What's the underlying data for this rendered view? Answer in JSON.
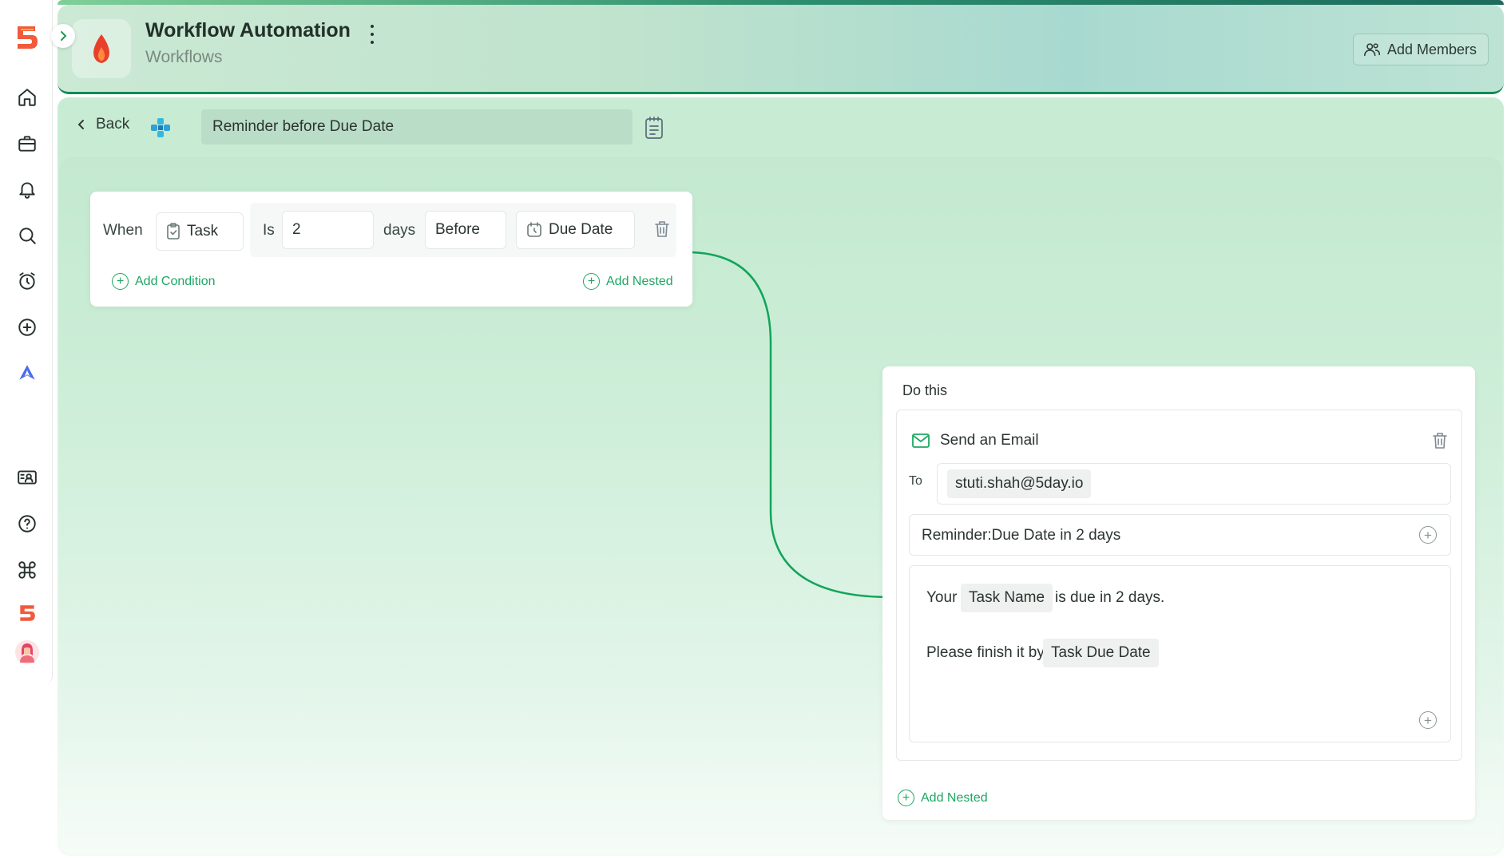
{
  "header": {
    "title": "Workflow Automation",
    "subtitle": "Workflows",
    "add_members_label": "Add Members"
  },
  "sidebar": {
    "items": [
      {
        "icon": "home-icon"
      },
      {
        "icon": "briefcase-icon"
      },
      {
        "icon": "bell-icon"
      },
      {
        "icon": "search-icon"
      },
      {
        "icon": "alarm-clock-icon"
      },
      {
        "icon": "plus-circle-icon"
      },
      {
        "icon": "rocket-a-icon"
      },
      {
        "icon": "support-card-icon"
      },
      {
        "icon": "help-icon"
      },
      {
        "icon": "command-icon"
      },
      {
        "icon": "brand-logo-icon"
      },
      {
        "icon": "user-avatar"
      }
    ]
  },
  "toolbar": {
    "back_label": "Back",
    "workflow_name": "Reminder before Due Date"
  },
  "trigger": {
    "when_label": "When",
    "entity": "Task",
    "is_label": "Is",
    "value": "2",
    "unit": "days",
    "relation": "Before",
    "field": "Due Date",
    "add_condition_label": "Add Condition",
    "add_nested_label": "Add Nested"
  },
  "action": {
    "section_label": "Do this",
    "type_label": "Send an Email",
    "to_label": "To",
    "to_value": "stuti.shah@5day.io",
    "subject": "Reminder:Due Date in 2 days",
    "body": {
      "line1_prefix": "Your",
      "line1_token": "Task Name",
      "line1_suffix": "is due in 2 days.",
      "line2_prefix": "Please finish it by",
      "line2_token": "Task Due Date"
    },
    "add_nested_label": "Add Nested"
  },
  "colors": {
    "accent": "#1ea762",
    "connector": "#12a55a"
  }
}
